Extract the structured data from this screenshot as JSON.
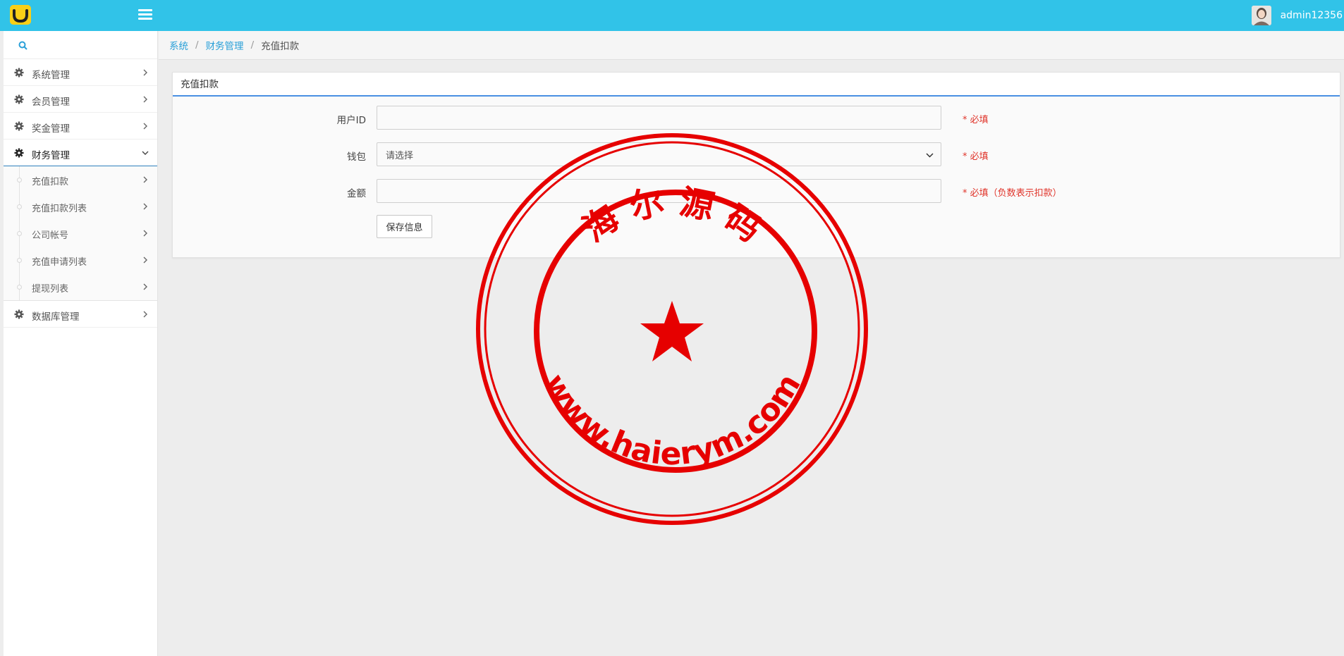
{
  "topbar": {
    "username": "admin12356",
    "accent_color": "#31c3e8",
    "logo_icon": "smiley-logo-icon",
    "menu_icon": "hamburger-icon"
  },
  "sidebar": {
    "search_placeholder": "",
    "items": [
      {
        "label": "系统管理",
        "icon": "gear-icon",
        "expanded": false
      },
      {
        "label": "会员管理",
        "icon": "gear-icon",
        "expanded": false
      },
      {
        "label": "奖金管理",
        "icon": "gear-icon",
        "expanded": false
      },
      {
        "label": "财务管理",
        "icon": "gear-icon",
        "expanded": true
      },
      {
        "label": "数据库管理",
        "icon": "gear-icon",
        "expanded": false
      }
    ],
    "finance_children": [
      {
        "label": "充值扣款"
      },
      {
        "label": "充值扣款列表"
      },
      {
        "label": "公司帐号"
      },
      {
        "label": "充值申请列表"
      },
      {
        "label": "提现列表"
      }
    ]
  },
  "breadcrumb": {
    "level1": "系统",
    "level2": "财务管理",
    "current": "充值扣款",
    "separator": "/"
  },
  "panel": {
    "title": "充值扣款",
    "fields": {
      "user_id": {
        "label": "用户ID",
        "value": "",
        "hint": "* 必填"
      },
      "wallet": {
        "label": "钱包",
        "selected": "请选择",
        "hint": "* 必填"
      },
      "amount": {
        "label": "金额",
        "value": "",
        "hint": "* 必填（负数表示扣款）"
      }
    },
    "save_label": "保存信息"
  },
  "watermark": {
    "top_text": "海 尔 源 码",
    "bottom_text": "www.haierym.com",
    "color": "#e60000"
  }
}
